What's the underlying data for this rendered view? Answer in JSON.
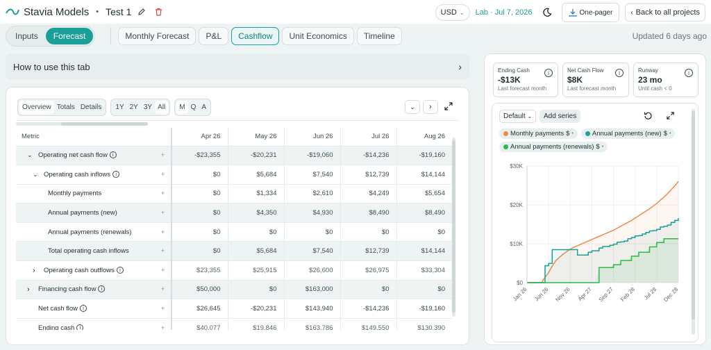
{
  "app": {
    "name": "Stavia Models",
    "project": "Test 1",
    "currency": "USD",
    "lab_text": "Lab · Jul 7, 2026",
    "one_pager": "One-pager",
    "back": "Back to all projects"
  },
  "mode_tabs": [
    {
      "label": "Inputs",
      "active": false
    },
    {
      "label": "Forecast",
      "active": true
    }
  ],
  "view_tabs": [
    {
      "label": "Monthly Forecast",
      "active": false
    },
    {
      "label": "P&L",
      "active": false
    },
    {
      "label": "Cashflow",
      "active": true
    },
    {
      "label": "Unit Economics",
      "active": false
    },
    {
      "label": "Timeline",
      "active": false
    }
  ],
  "updated": "Updated 6 days ago",
  "howto": "How to use this tab",
  "table_controls": {
    "views": [
      "Overview",
      "Totals",
      "Details"
    ],
    "ranges": [
      "1Y",
      "2Y",
      "3Y",
      "All"
    ],
    "periods": [
      "M",
      "Q",
      "A"
    ]
  },
  "table": {
    "metric_header": "Metric",
    "months": [
      "Apr 26",
      "May 26",
      "Jun 26",
      "Jul 26",
      "Aug 26"
    ],
    "rows": [
      {
        "label": "Operating net cash flow",
        "chev": "v",
        "info": true,
        "indent": 0,
        "shade": true,
        "values": [
          "-$23,355",
          "-$20,231",
          "-$19,060",
          "-$14,236",
          "-$19,160"
        ]
      },
      {
        "label": "Operating cash inflows",
        "chev": "v",
        "info": true,
        "indent": 1,
        "shade": false,
        "values": [
          "$0",
          "$5,684",
          "$7,540",
          "$12,739",
          "$14,144"
        ]
      },
      {
        "label": "Monthly payments",
        "chev": "",
        "info": false,
        "indent": 2,
        "shade": false,
        "values": [
          "$0",
          "$1,334",
          "$2,610",
          "$4,249",
          "$5,654"
        ]
      },
      {
        "label": "Annual payments (new)",
        "chev": "",
        "info": false,
        "indent": 2,
        "shade": true,
        "values": [
          "$0",
          "$4,350",
          "$4,930",
          "$8,490",
          "$8,490"
        ]
      },
      {
        "label": "Annual payments (renewals)",
        "chev": "",
        "info": false,
        "indent": 2,
        "shade": false,
        "values": [
          "$0",
          "$0",
          "$0",
          "$0",
          "$0"
        ]
      },
      {
        "label": "Total operating cash inflows",
        "chev": "",
        "info": false,
        "indent": 2,
        "shade": true,
        "values": [
          "$0",
          "$5,684",
          "$7,540",
          "$12,739",
          "$14,144"
        ]
      },
      {
        "label": "Operating cash outflows",
        "chev": ">",
        "info": true,
        "indent": 1,
        "shade": false,
        "values": [
          "$23,355",
          "$25,915",
          "$26,600",
          "$26,975",
          "$33,304"
        ]
      },
      {
        "label": "Financing cash flow",
        "chev": ">",
        "info": true,
        "indent": 0,
        "shade": true,
        "values": [
          "$50,000",
          "$0",
          "$163,000",
          "$0",
          "$0"
        ]
      },
      {
        "label": "Net cash flow",
        "chev": "",
        "info": true,
        "indent": 0,
        "shade": false,
        "values": [
          "$26,645",
          "-$20,231",
          "$143,940",
          "-$14,236",
          "-$19,160"
        ]
      },
      {
        "label": "Ending cash",
        "chev": "",
        "info": true,
        "indent": 0,
        "shade": false,
        "values": [
          "$40,077",
          "$19,846",
          "$163,786",
          "$149,550",
          "$130,390"
        ]
      }
    ]
  },
  "kpis": [
    {
      "label": "Ending Cash",
      "value": "-$13K",
      "sub": "Last forecast month"
    },
    {
      "label": "Net Cash Flow",
      "value": "$8K",
      "sub": "Last forecast month"
    },
    {
      "label": "Runway",
      "value": "23 mo",
      "sub": "Until cash < 0"
    }
  ],
  "chart_controls": {
    "preset": "Default",
    "add": "Add series"
  },
  "colors": {
    "accent": "#1a9e98",
    "monthly": "#f08a4b",
    "annual_new": "#1a9e98",
    "annual_renewals": "#2fb84a"
  },
  "chart_data": {
    "type": "line",
    "y_ticks": [
      "$0",
      "$10K",
      "$20K",
      "$30K"
    ],
    "ylim": [
      0,
      30000
    ],
    "x_ticks": [
      "Jan 26",
      "Jun 26",
      "Nov 26",
      "Apr 27",
      "Sep 27",
      "Feb 28",
      "Jul 28",
      "Dec 28"
    ],
    "series": [
      {
        "name": "Monthly payments",
        "unit": "$",
        "values": [
          0,
          0,
          0,
          0,
          0,
          1334,
          2610,
          4249,
          5654,
          6500,
          7300,
          8000,
          8600,
          9100,
          9500,
          9900,
          10300,
          10700,
          11100,
          11500,
          11900,
          12300,
          12700,
          13100,
          13500,
          14000,
          14500,
          15000,
          15500,
          16000,
          16600,
          17200,
          17800,
          18400,
          19000,
          19700,
          20400,
          21200,
          22000,
          22900,
          23900,
          24900,
          26000
        ]
      },
      {
        "name": "Annual payments (new)",
        "unit": "$",
        "values": [
          0,
          0,
          0,
          0,
          0,
          4350,
          4930,
          8490,
          8490,
          8490,
          8490,
          8490,
          8490,
          8490,
          7100,
          7100,
          7100,
          7800,
          8200,
          8200,
          8900,
          9300,
          9300,
          9600,
          9900,
          10400,
          10500,
          10700,
          11300,
          11600,
          12000,
          12100,
          12500,
          12900,
          13300,
          13400,
          13700,
          14300,
          14500,
          14800,
          15500,
          16000,
          16600
        ]
      },
      {
        "name": "Annual payments (renewals)",
        "unit": "$",
        "values": [
          0,
          0,
          0,
          0,
          0,
          0,
          0,
          0,
          0,
          0,
          0,
          0,
          0,
          0,
          0,
          0,
          0,
          0,
          0,
          0,
          3900,
          3900,
          3900,
          3900,
          4600,
          4600,
          5700,
          5700,
          5700,
          6800,
          6800,
          7800,
          7800,
          7800,
          9200,
          9200,
          10300,
          10300,
          11300,
          11300,
          11300,
          11300,
          11300
        ]
      }
    ]
  }
}
